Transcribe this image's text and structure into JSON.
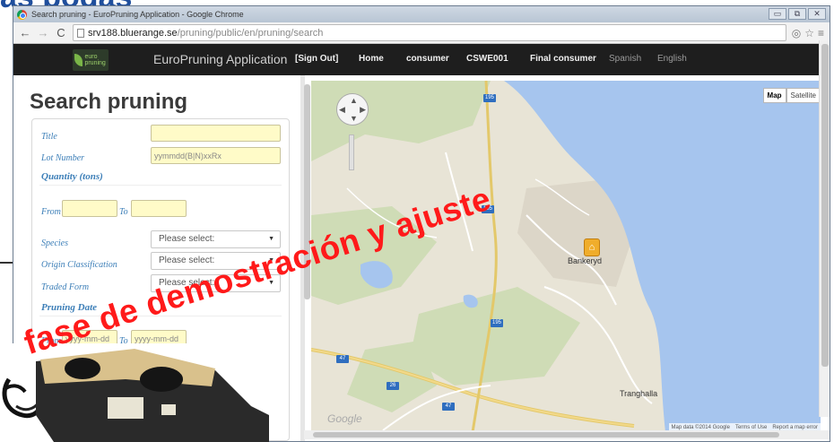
{
  "slide": {
    "title_fragment": "as podas"
  },
  "browser": {
    "window_title": "Search pruning - EuroPruning Application - Google Chrome",
    "url_host": "srv188.bluerange.se",
    "url_path": "/pruning/public/en/pruning/search",
    "window_controls": [
      "▭",
      "⧉",
      "✕"
    ],
    "nav_icons": {
      "back": "arrow-left-icon",
      "forward": "arrow-right-icon",
      "reload": "reload-icon",
      "page": "page-icon"
    }
  },
  "app": {
    "logo_text": "euro pruning",
    "title": "EuroPruning Application",
    "nav": [
      {
        "label": "[Sign Out]"
      },
      {
        "label": "Home"
      },
      {
        "label": "consumer"
      },
      {
        "label": "CSWE001"
      },
      {
        "label": "Final consumer"
      },
      {
        "label": "Spanish"
      },
      {
        "label": "English"
      }
    ]
  },
  "search": {
    "heading": "Search pruning",
    "title_label": "Title",
    "title_value": "",
    "lot_label": "Lot Number",
    "lot_placeholder": "yymmdd(B|N)xxRx",
    "quantity_label": "Quantity (tons)",
    "from_label": "From",
    "to_label": "To",
    "species_label": "Species",
    "species_value": "Please select:",
    "origin_label": "Origin Classification",
    "origin_value": "Please select:",
    "traded_label": "Traded Form",
    "traded_value": "Please select:",
    "pruning_date_label": "Pruning Date",
    "date_from_placeholder": "yyyy-mm-dd",
    "date_to_placeholder": "yyyy-mm-dd"
  },
  "map": {
    "type_buttons": [
      "Map",
      "Satellite"
    ],
    "active_type": "Map",
    "town_labels": [
      "Bankeryd",
      "Tranghalla"
    ],
    "road_numbers": [
      "195",
      "195",
      "195",
      "47",
      "26",
      "47"
    ],
    "attribution": [
      "Map data ©2014 Google",
      "Terms of Use",
      "Report a map error"
    ],
    "provider": "Google",
    "colors": {
      "water": "#a6c5ee",
      "land": "#e8e4d6",
      "forest": "#cfdcb6",
      "urban": "#dcd6c8"
    }
  },
  "overlay": {
    "watermark": "fase de demostración y ajuste",
    "watermark_color": "#ff1a1a"
  }
}
